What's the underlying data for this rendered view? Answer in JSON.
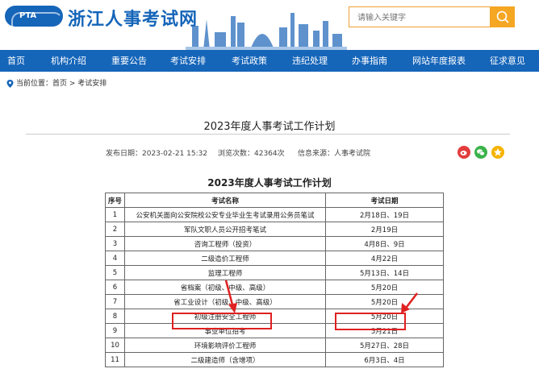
{
  "header": {
    "logo_text": "PTA",
    "site_title": "浙江人事考试网",
    "search_placeholder": "请输入关键字"
  },
  "nav": [
    {
      "label": "首页"
    },
    {
      "label": "机构介绍"
    },
    {
      "label": "重要公告"
    },
    {
      "label": "考试安排"
    },
    {
      "label": "考试政策"
    },
    {
      "label": "违纪处理"
    },
    {
      "label": "办事指南"
    },
    {
      "label": "网站年度报表"
    },
    {
      "label": "征求意见"
    }
  ],
  "breadcrumb": {
    "prefix": "当前位置：",
    "home": "首页",
    "sep": " > ",
    "current": "考试安排"
  },
  "article": {
    "title": "2023年度人事考试工作计划",
    "publish_date": "发布日期：2023-02-21 15:32",
    "views": "浏览次数：42364次",
    "source": "信息来源：人事考试院"
  },
  "share_icons": [
    "weibo-icon",
    "wechat-icon",
    "favorite-icon"
  ],
  "colors": {
    "brand": "#1565b9",
    "accent": "#f5a623",
    "highlight": "#e02020"
  },
  "table": {
    "title": "2023年度人事考试工作计划",
    "headers": [
      "序号",
      "考试名称",
      "考试日期"
    ],
    "rows": [
      [
        "1",
        "公安机关面向公安院校公安专业毕业生考试录用公务员笔试",
        "2月18日、19日"
      ],
      [
        "2",
        "军队文职人员公开招考笔试",
        "2月19日"
      ],
      [
        "3",
        "咨询工程师（投资）",
        "4月8日、9日"
      ],
      [
        "4",
        "二级造价工程师",
        "4月22日"
      ],
      [
        "5",
        "监理工程师",
        "5月13日、14日"
      ],
      [
        "6",
        "省档案（初级、中级、高级）",
        "5月20日"
      ],
      [
        "7",
        "省工业设计（初级、中级、高级）",
        "5月20日"
      ],
      [
        "8",
        "初级注册安全工程师",
        "5月20日"
      ],
      [
        "9",
        "事业单位招考",
        "5月21日"
      ],
      [
        "10",
        "环境影响评价工程师",
        "5月27日、28日"
      ],
      [
        "11",
        "二级建造师（含增项）",
        "6月3日、4日"
      ]
    ]
  }
}
